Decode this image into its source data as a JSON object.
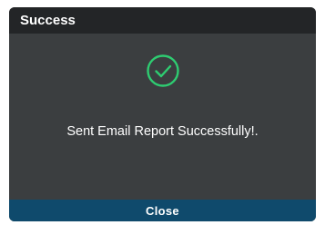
{
  "dialog": {
    "title": "Success",
    "message": "Sent Email Report Successfully!.",
    "close_label": "Close",
    "icon": "check-circle-icon"
  },
  "colors": {
    "titlebar": "#232527",
    "body": "#3b3e40",
    "accent_green": "#2ecc71",
    "button": "#0f4a6c"
  }
}
